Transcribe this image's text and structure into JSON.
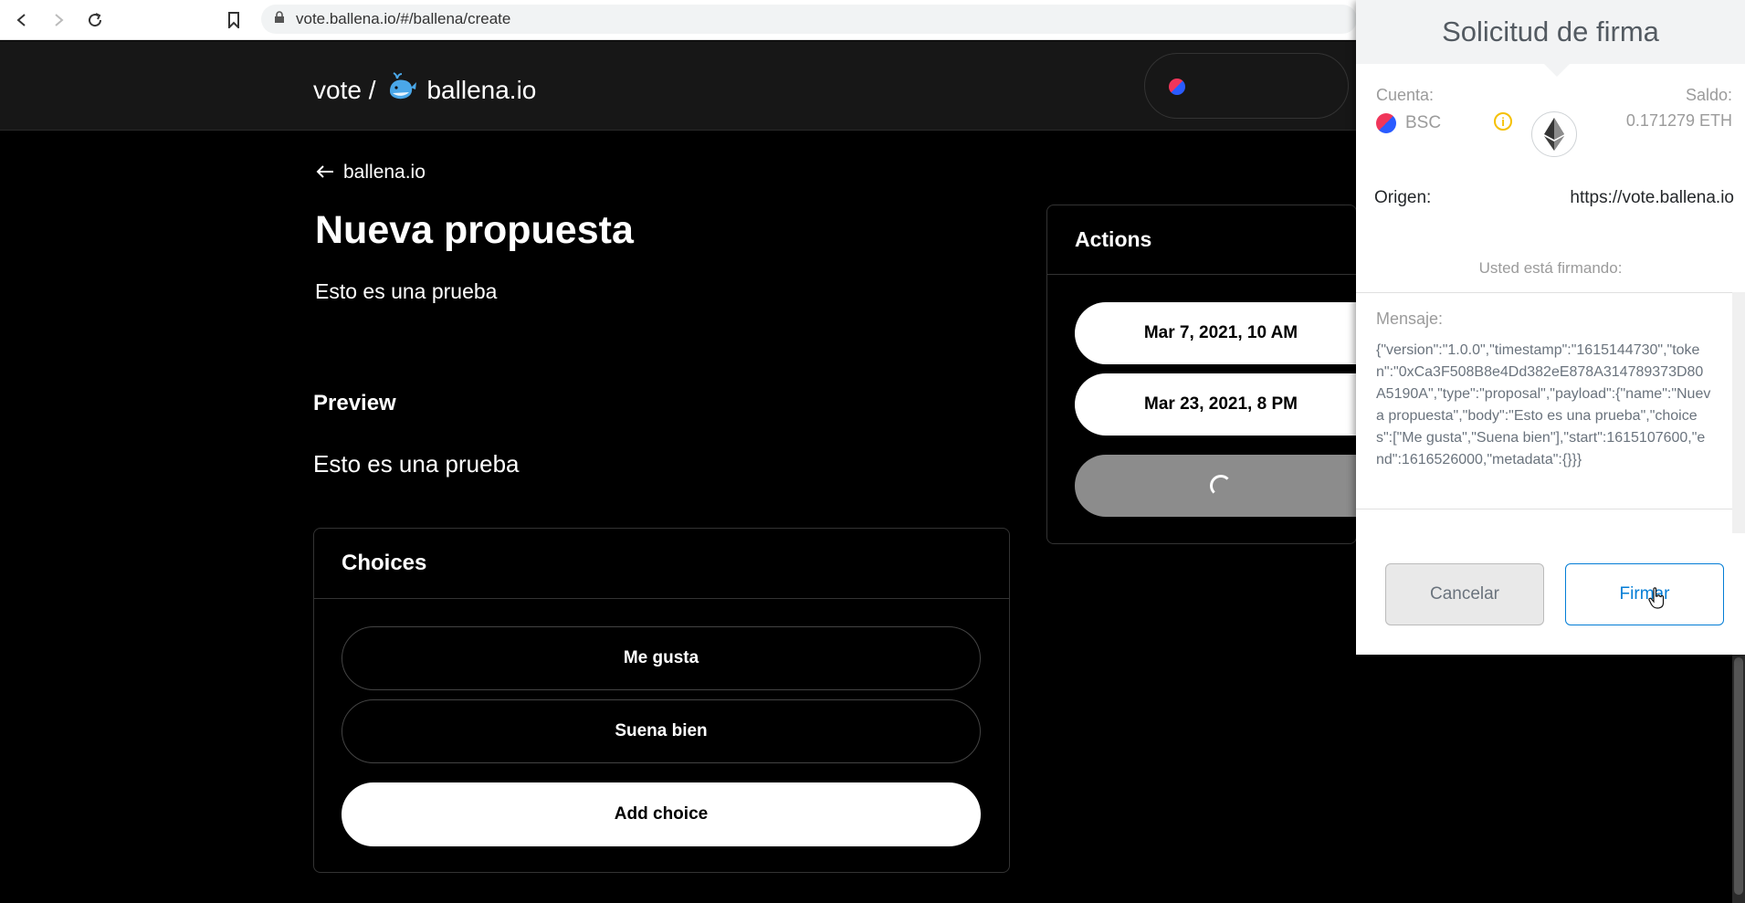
{
  "browser": {
    "url": "vote.ballena.io/#/ballena/create"
  },
  "header": {
    "brand_prefix": "vote /",
    "brand_name": "ballena.io"
  },
  "main": {
    "back_link": "ballena.io",
    "title": "Nueva propuesta",
    "description": "Esto es una prueba",
    "preview_heading": "Preview",
    "preview_text": "Esto es una prueba",
    "choices": {
      "heading": "Choices",
      "items": [
        "Me gusta",
        "Suena bien"
      ],
      "add_label": "Add choice"
    },
    "actions": {
      "heading": "Actions",
      "start_date": "Mar 7, 2021, 10 AM",
      "end_date": "Mar 23, 2021, 8 PM"
    }
  },
  "popup": {
    "title": "Solicitud de firma",
    "account_label": "Cuenta:",
    "account_name": "BSC",
    "balance_label": "Saldo:",
    "balance_value": "0.171279 ETH",
    "origin_label": "Origen:",
    "origin_value": "https://vote.ballena.io",
    "signing_note": "Usted está firmando:",
    "message_label": "Mensaje:",
    "message_body": "{\"version\":\"1.0.0\",\"timestamp\":\"1615144730\",\"token\":\"0xCa3F508B8e4Dd382eE878A314789373D80A5190A\",\"type\":\"proposal\",\"payload\":{\"name\":\"Nueva propuesta\",\"body\":\"Esto es una prueba\",\"choices\":[\"Me gusta\",\"Suena bien\"],\"start\":1615107600,\"end\":1616526000,\"metadata\":{}}}",
    "cancel_label": "Cancelar",
    "sign_label": "Firmar"
  },
  "colors": {
    "accent_blue": "#037dd6",
    "warning_yellow": "#f5c000",
    "page_bg": "#000000",
    "header_bg": "#171717"
  }
}
